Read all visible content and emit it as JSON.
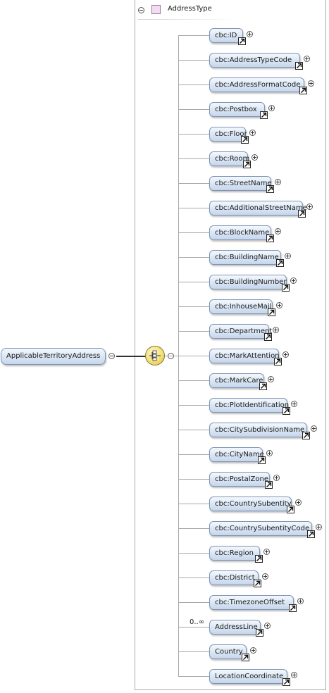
{
  "type_header": {
    "title": "AddressType"
  },
  "root_element": {
    "label": "ApplicableTerritoryAddress"
  },
  "sequence": {
    "icon": "sequence-compositor-icon"
  },
  "children": [
    {
      "label": "cbc:ID"
    },
    {
      "label": "cbc:AddressTypeCode"
    },
    {
      "label": "cbc:AddressFormatCode"
    },
    {
      "label": "cbc:Postbox"
    },
    {
      "label": "cbc:Floor"
    },
    {
      "label": "cbc:Room"
    },
    {
      "label": "cbc:StreetName"
    },
    {
      "label": "cbc:AdditionalStreetName"
    },
    {
      "label": "cbc:BlockName"
    },
    {
      "label": "cbc:BuildingName"
    },
    {
      "label": "cbc:BuildingNumber"
    },
    {
      "label": "cbc:InhouseMail"
    },
    {
      "label": "cbc:Department"
    },
    {
      "label": "cbc:MarkAttention"
    },
    {
      "label": "cbc:MarkCare"
    },
    {
      "label": "cbc:PlotIdentification"
    },
    {
      "label": "cbc:CitySubdivisionName"
    },
    {
      "label": "cbc:CityName"
    },
    {
      "label": "cbc:PostalZone"
    },
    {
      "label": "cbc:CountrySubentity"
    },
    {
      "label": "cbc:CountrySubentityCode"
    },
    {
      "label": "cbc:Region"
    },
    {
      "label": "cbc:District"
    },
    {
      "label": "cbc:TimezoneOffset"
    },
    {
      "label": "AddressLine",
      "occurrence": "0..∞"
    },
    {
      "label": "Country"
    },
    {
      "label": "LocationCoordinate"
    }
  ],
  "colors": {
    "node_fill": "#d9e5f4",
    "node_border": "#7f95b3",
    "sequence_fill": "#f3df7a"
  }
}
